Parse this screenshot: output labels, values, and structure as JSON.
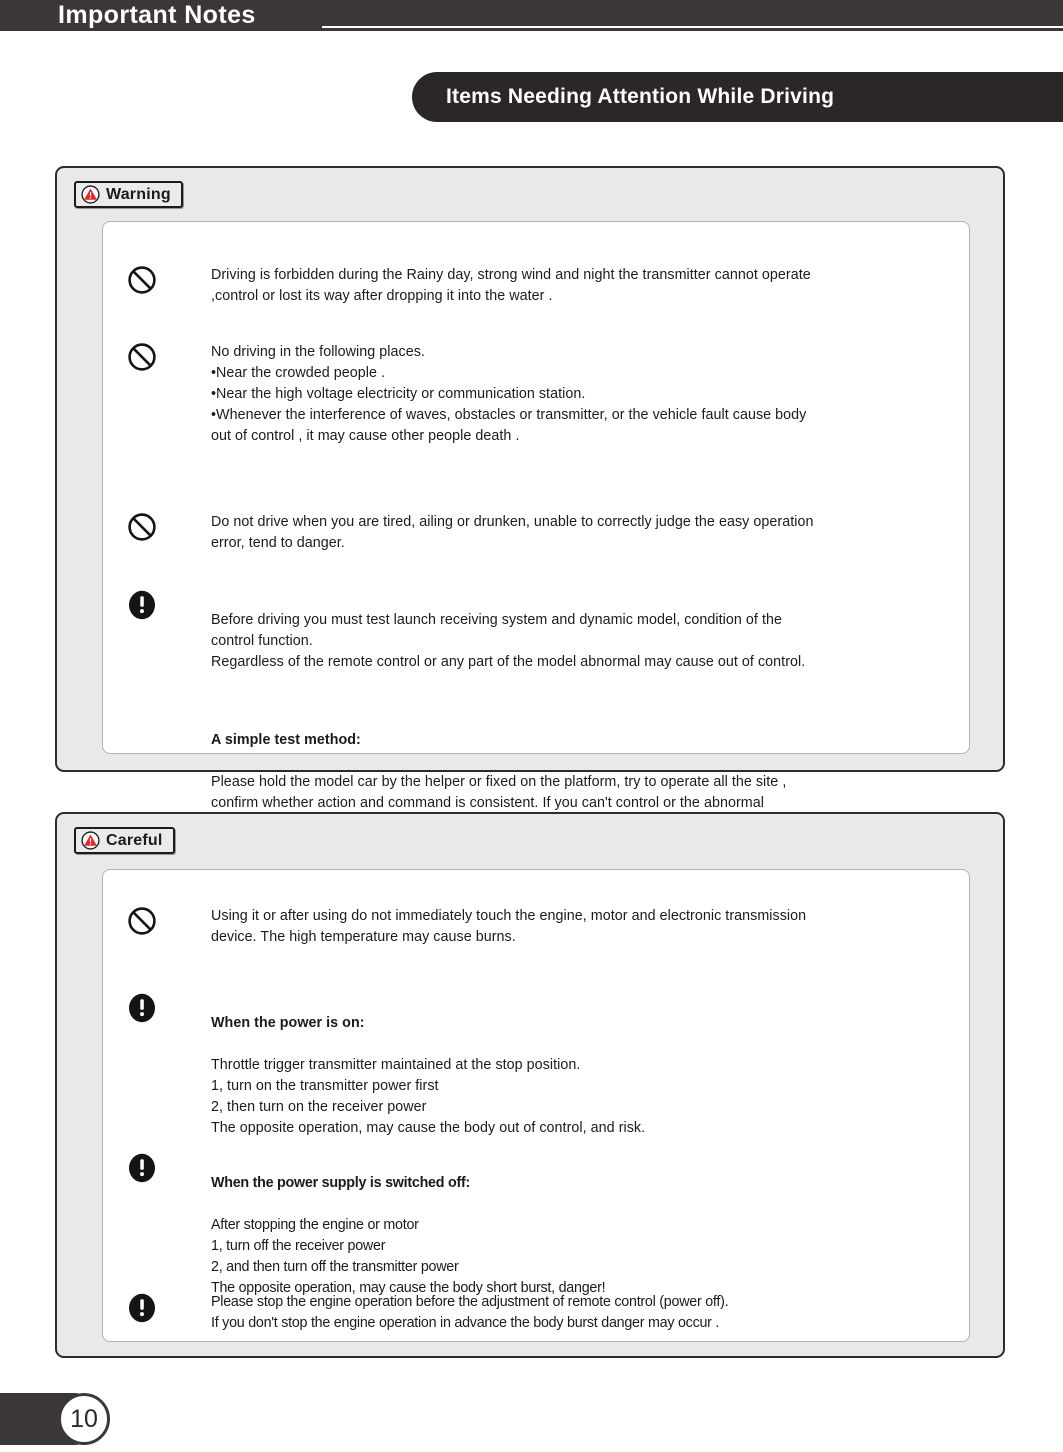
{
  "header": {
    "title": "Important Notes"
  },
  "banner": {
    "title": "Items Needing Attention While Driving"
  },
  "sections": [
    {
      "id": "warning",
      "badge_label": "Warning",
      "badge_icon": "warning-triangle-icon",
      "items": [
        {
          "icon": "prohibition-icon",
          "text": "Driving is forbidden during the Rainy day, strong wind and night the transmitter cannot operate\n,control or lost its way after dropping  it into the water ."
        },
        {
          "icon": "prohibition-icon",
          "text": "No driving in the following places.\n•Near the crowded people .\n•Near the high voltage electricity or communication station.\n•Whenever the interference of waves, obstacles or transmitter, or the vehicle fault cause body\nout of control ,  it may cause other people death ."
        },
        {
          "icon": "prohibition-icon",
          "text": "Do not drive when you are tired, ailing or drunken, unable to correctly judge the easy operation\nerror, tend to danger."
        },
        {
          "icon": "exclamation-icon",
          "text": "Before driving you must test launch receiving system and dynamic model, condition of the\ncontrol function.\nRegardless of the remote control or any part of the model abnormal may cause out of control.",
          "heading": "A simple test method:",
          "text2": "Please hold the model car by the helper or fixed on the platform, try to operate all the site ,\nconfirm whether action and command is consistent. If you can't control or the abnormal\nmovement."
        }
      ]
    },
    {
      "id": "careful",
      "badge_label": "Careful",
      "badge_icon": "warning-triangle-icon",
      "items": [
        {
          "icon": "prohibition-icon",
          "text": "Using it or after using do not immediately  touch the engine, motor and electronic transmission\ndevice. The high temperature may cause burns."
        },
        {
          "icon": "exclamation-icon",
          "heading": "When the power is on:",
          "text": "Throttle trigger transmitter maintained at the stop position.\n1, turn on the transmitter power first\n2, then turn on the receiver power\nThe opposite operation, may cause the body out of control, and risk."
        },
        {
          "icon": "exclamation-icon",
          "heading": "When the power supply is switched off:",
          "text": "After stopping  the engine or motor\n1,  turn off the receiver  power\n2,  and then turn off the transmitter power\nThe opposite operation, may cause the body short burst, danger!"
        },
        {
          "icon": "exclamation-icon",
          "text": "Please stop the engine operation before the adjustment of remote control (power off).\nIf you don't stop the engine operation in advance  the body burst danger may occur ."
        }
      ]
    }
  ],
  "footer": {
    "page_number": "10"
  },
  "colors": {
    "header_bar": "#3b3738",
    "banner": "#2b2728",
    "panel_fill": "#e9e9e9",
    "panel_border": "#2c2c2c",
    "card_fill": "#ffffff",
    "warning_red": "#e8242a",
    "text": "#1b1b1b"
  }
}
